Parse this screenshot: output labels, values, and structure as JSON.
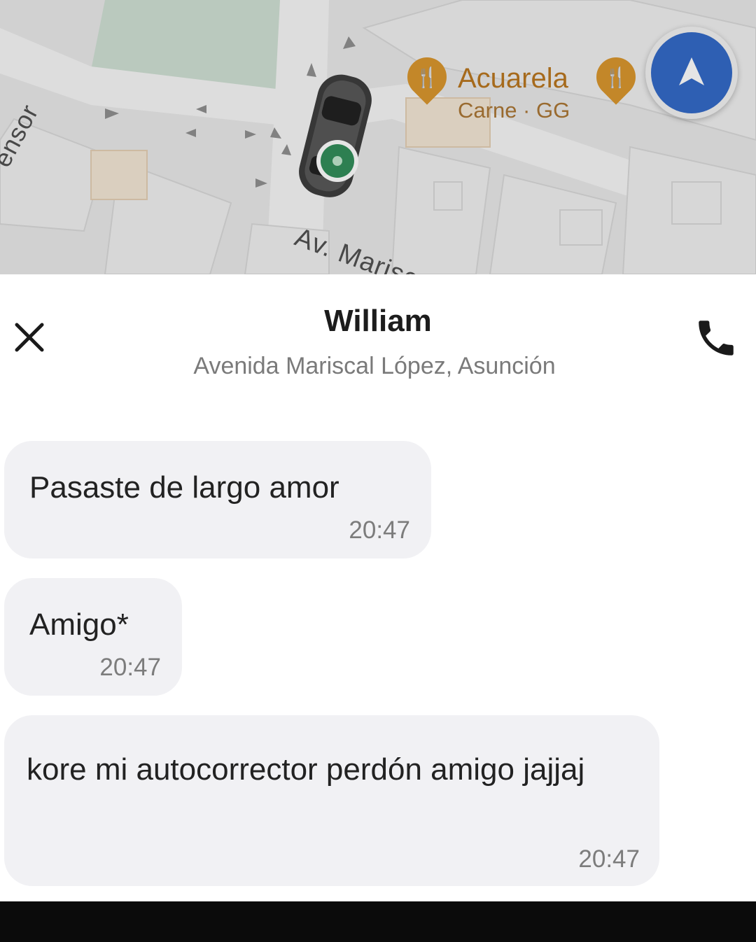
{
  "map": {
    "street_main": "Av. Marisca",
    "street_side": "ensor",
    "poi": {
      "name": "Acuarela",
      "category": "Carne · GG"
    },
    "poi2_icon": "restaurant-icon",
    "compass_icon": "navigation-arrow-icon",
    "car_icon": "car-icon",
    "colors": {
      "poi": "#d9942a",
      "compass": "#2f67c7",
      "pickup_marker": "#2e8b57"
    }
  },
  "chat_header": {
    "title": "William",
    "subtitle": "Avenida Mariscal López, Asunción",
    "close_icon": "close-icon",
    "call_icon": "phone-icon"
  },
  "messages": [
    {
      "text": "Pasaste de largo amor",
      "time": "20:47"
    },
    {
      "text": "Amigo*",
      "time": "20:47"
    },
    {
      "text": "kore mi autocorrector perdón amigo jajjaj",
      "time": "20:47"
    }
  ]
}
